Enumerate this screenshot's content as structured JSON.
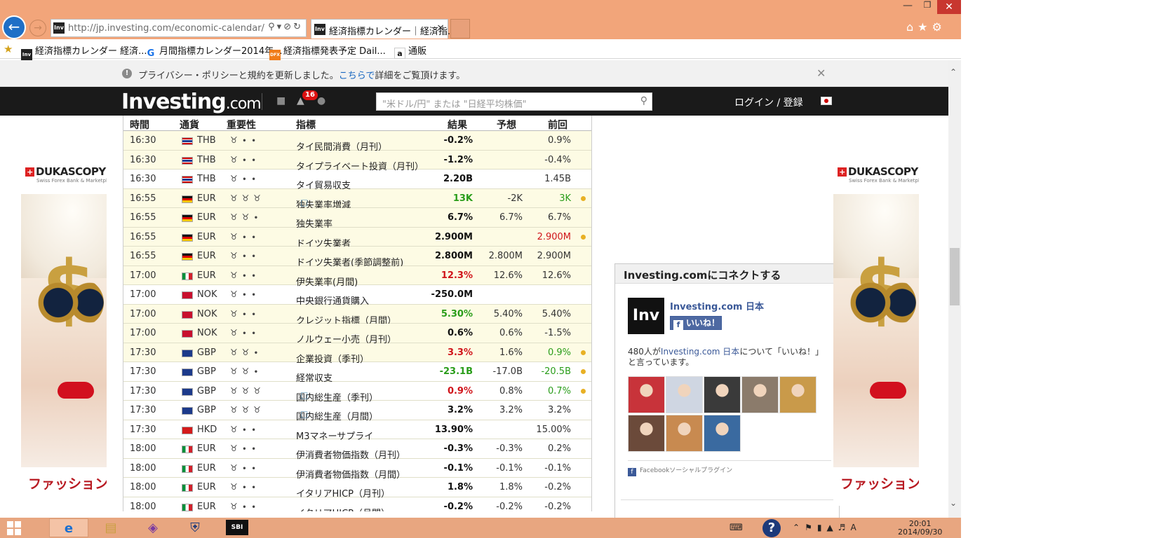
{
  "browser": {
    "url": "http://jp.investing.com/economic-calendar/",
    "url_host": "jp.investing.com",
    "tab_title": "経済指標カレンダー｜経済指...",
    "favorites": [
      {
        "label": "経済指標カレンダー 経済...",
        "icon": "Inv"
      },
      {
        "label": "月間指標カレンダー2014年...",
        "icon": "G"
      },
      {
        "label": "経済指標発表予定 Dail...",
        "icon": "DFX"
      },
      {
        "label": "通販",
        "icon": "a"
      }
    ]
  },
  "notice": {
    "text_before": "プライバシー・ポリシーと規約を更新しました。",
    "link": "こちらで",
    "text_after": "詳細をご覧頂けます。"
  },
  "header": {
    "logo_main": "Investing",
    "logo_suffix": ".com",
    "badge_count": "16",
    "search_placeholder": "\"米ドル/円\" または \"日経平均株価\"",
    "login": "ログイン / 登録"
  },
  "calendar": {
    "columns": [
      "時間",
      "通貨",
      "重要性",
      "指標",
      "結果",
      "予想",
      "前回"
    ],
    "rows": [
      {
        "time": "16:30",
        "flag": "th",
        "currency": "THB",
        "importance": 1,
        "name": "タイ民間消費（月刊）",
        "actual": "-0.2%",
        "actual_color": "",
        "forecast": "",
        "previous": "0.9%",
        "previous_color": "",
        "dot": false,
        "chat": false
      },
      {
        "time": "16:30",
        "flag": "th",
        "currency": "THB",
        "importance": 1,
        "name": "タイプライベート投資（月刊）",
        "actual": "-1.2%",
        "actual_color": "",
        "forecast": "",
        "previous": "-0.4%",
        "previous_color": "",
        "dot": false,
        "chat": false
      },
      {
        "time": "16:30",
        "flag": "th",
        "currency": "THB",
        "importance": 1,
        "name": "タイ貿易収支",
        "actual": "2.20B",
        "actual_color": "",
        "forecast": "",
        "previous": "1.45B",
        "previous_color": "",
        "dot": false,
        "chat": false
      },
      {
        "time": "16:55",
        "flag": "de",
        "currency": "EUR",
        "importance": 3,
        "name": "独失業率増減",
        "actual": "13K",
        "actual_color": "pos",
        "forecast": "-2K",
        "previous": "3K",
        "previous_color": "pos",
        "dot": true,
        "chat": true
      },
      {
        "time": "16:55",
        "flag": "de",
        "currency": "EUR",
        "importance": 2,
        "name": "独失業率",
        "actual": "6.7%",
        "actual_color": "",
        "forecast": "6.7%",
        "previous": "6.7%",
        "previous_color": "",
        "dot": false,
        "chat": false
      },
      {
        "time": "16:55",
        "flag": "de",
        "currency": "EUR",
        "importance": 1,
        "name": "ドイツ失業者",
        "actual": "2.900M",
        "actual_color": "",
        "forecast": "",
        "previous": "2.900M",
        "previous_color": "neg",
        "dot": true,
        "chat": false
      },
      {
        "time": "16:55",
        "flag": "de",
        "currency": "EUR",
        "importance": 1,
        "name": "ドイツ失業者(季節調整前)",
        "actual": "2.800M",
        "actual_color": "",
        "forecast": "2.800M",
        "previous": "2.900M",
        "previous_color": "",
        "dot": false,
        "chat": false
      },
      {
        "time": "17:00",
        "flag": "it",
        "currency": "EUR",
        "importance": 1,
        "name": "伊失業率(月間)",
        "actual": "12.3%",
        "actual_color": "neg",
        "forecast": "12.6%",
        "previous": "12.6%",
        "previous_color": "",
        "dot": false,
        "chat": false
      },
      {
        "time": "17:00",
        "flag": "no",
        "currency": "NOK",
        "importance": 1,
        "name": "中央銀行通貨購入",
        "actual": "-250.0M",
        "actual_color": "",
        "forecast": "",
        "previous": "",
        "previous_color": "",
        "dot": false,
        "chat": false
      },
      {
        "time": "17:00",
        "flag": "no",
        "currency": "NOK",
        "importance": 1,
        "name": "クレジット指標（月間）",
        "actual": "5.30%",
        "actual_color": "pos",
        "forecast": "5.40%",
        "previous": "5.40%",
        "previous_color": "",
        "dot": false,
        "chat": false
      },
      {
        "time": "17:00",
        "flag": "no",
        "currency": "NOK",
        "importance": 1,
        "name": "ノルウェー小売（月刊）",
        "actual": "0.6%",
        "actual_color": "",
        "forecast": "0.6%",
        "previous": "-1.5%",
        "previous_color": "",
        "dot": false,
        "chat": false
      },
      {
        "time": "17:30",
        "flag": "gb",
        "currency": "GBP",
        "importance": 2,
        "name": "企業投資（季刊）",
        "actual": "3.3%",
        "actual_color": "neg",
        "forecast": "1.6%",
        "previous": "0.9%",
        "previous_color": "pos",
        "dot": true,
        "chat": false
      },
      {
        "time": "17:30",
        "flag": "gb",
        "currency": "GBP",
        "importance": 2,
        "name": "経常収支",
        "actual": "-23.1B",
        "actual_color": "pos",
        "forecast": "-17.0B",
        "previous": "-20.5B",
        "previous_color": "pos",
        "dot": true,
        "chat": false
      },
      {
        "time": "17:30",
        "flag": "gb",
        "currency": "GBP",
        "importance": 3,
        "name": "国内総生産（季刊）",
        "actual": "0.9%",
        "actual_color": "neg",
        "forecast": "0.8%",
        "previous": "0.7%",
        "previous_color": "pos",
        "dot": true,
        "chat": true
      },
      {
        "time": "17:30",
        "flag": "gb",
        "currency": "GBP",
        "importance": 3,
        "name": "国内総生産（月間）",
        "actual": "3.2%",
        "actual_color": "",
        "forecast": "3.2%",
        "previous": "3.2%",
        "previous_color": "",
        "dot": false,
        "chat": true
      },
      {
        "time": "17:30",
        "flag": "hk",
        "currency": "HKD",
        "importance": 1,
        "name": "M3マネーサプライ",
        "actual": "13.90%",
        "actual_color": "",
        "forecast": "",
        "previous": "15.00%",
        "previous_color": "",
        "dot": false,
        "chat": false
      },
      {
        "time": "18:00",
        "flag": "it",
        "currency": "EUR",
        "importance": 1,
        "name": "伊消費者物価指数（月刊）",
        "actual": "-0.3%",
        "actual_color": "",
        "forecast": "-0.3%",
        "previous": "0.2%",
        "previous_color": "",
        "dot": false,
        "chat": false
      },
      {
        "time": "18:00",
        "flag": "it",
        "currency": "EUR",
        "importance": 1,
        "name": "伊消費者物価指数（月間）",
        "actual": "-0.1%",
        "actual_color": "",
        "forecast": "-0.1%",
        "previous": "-0.1%",
        "previous_color": "",
        "dot": false,
        "chat": false
      },
      {
        "time": "18:00",
        "flag": "it",
        "currency": "EUR",
        "importance": 1,
        "name": "イタリアHICP（月刊）",
        "actual": "1.8%",
        "actual_color": "",
        "forecast": "1.8%",
        "previous": "-0.2%",
        "previous_color": "",
        "dot": false,
        "chat": false
      },
      {
        "time": "18:00",
        "flag": "it",
        "currency": "EUR",
        "importance": 1,
        "name": "イタリアHICP（月間）",
        "actual": "-0.2%",
        "actual_color": "",
        "forecast": "-0.2%",
        "previous": "-0.2%",
        "previous_color": "",
        "dot": false,
        "chat": false
      }
    ]
  },
  "ads": {
    "brand": "DUKASCOPY",
    "brand_sub": "Swiss Forex Bank & Marketplace",
    "caption": "ファッション"
  },
  "facebook": {
    "title": "Investing.comにコネクトする",
    "logo": "Inv",
    "page_name": "Investing.com 日本",
    "like_label": "いいね！",
    "count_prefix": "480人が",
    "count_link": "Investing.com 日本",
    "count_suffix": "について「いいね！」と言っています。",
    "plugin_label": "Facebookソーシャルプラグイン",
    "face_colors": [
      "#c8333a",
      "#cfd6e2",
      "#3a3a3a",
      "#8b7b6b",
      "#c99a4a",
      "#6b4a3a",
      "#c88a50",
      "#3a6aa0"
    ]
  },
  "taskbar": {
    "time": "20:01",
    "date": "2014/09/30",
    "ime": "A"
  }
}
